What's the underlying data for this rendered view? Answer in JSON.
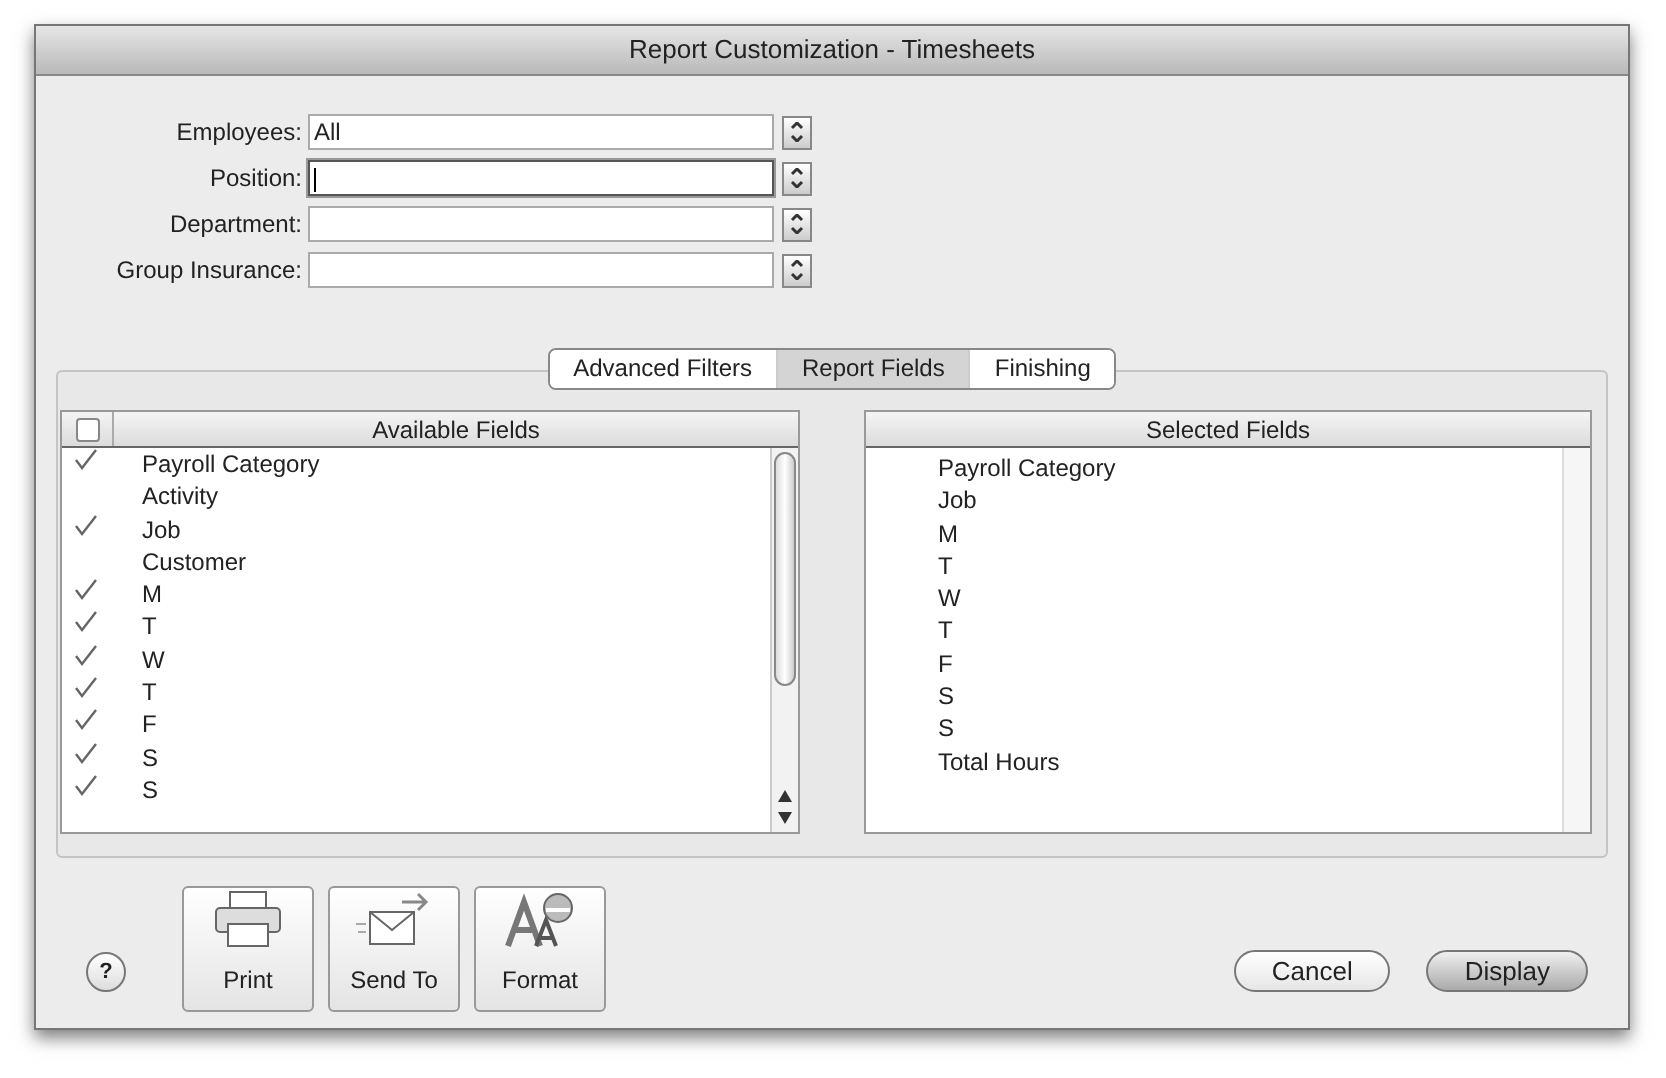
{
  "window": {
    "title": "Report Customization - Timesheets"
  },
  "filters": [
    {
      "label": "Employees:",
      "value": "All",
      "focused": false
    },
    {
      "label": "Position:",
      "focused": true
    },
    {
      "label": "Department:",
      "focused": false
    },
    {
      "label": "Group Insurance:",
      "focused": false
    }
  ],
  "tabs": [
    {
      "label": "Advanced Filters",
      "selected": false
    },
    {
      "label": "Report Fields",
      "selected": true
    },
    {
      "label": "Finishing",
      "selected": false
    }
  ],
  "available_fields": {
    "header": "Available Fields",
    "select_all_checked": false,
    "items": [
      {
        "label": "Payroll Category",
        "checked": true
      },
      {
        "label": "Activity",
        "checked": false
      },
      {
        "label": "Job",
        "checked": true
      },
      {
        "label": "Customer",
        "checked": false
      },
      {
        "label": "M",
        "checked": true
      },
      {
        "label": "T",
        "checked": true
      },
      {
        "label": "W",
        "checked": true
      },
      {
        "label": "T",
        "checked": true
      },
      {
        "label": "F",
        "checked": true
      },
      {
        "label": "S",
        "checked": true
      },
      {
        "label": "S",
        "checked": true
      }
    ]
  },
  "selected_fields": {
    "header": "Selected Fields",
    "items": [
      "Payroll Category",
      "Job",
      "M",
      "T",
      "W",
      "T",
      "F",
      "S",
      "S",
      "Total Hours"
    ]
  },
  "toolbar": [
    {
      "kind": "print",
      "label": "Print"
    },
    {
      "kind": "send",
      "label": "Send To"
    },
    {
      "kind": "format",
      "label": "Format"
    }
  ],
  "help": "?",
  "buttons": [
    {
      "label": "Cancel",
      "default": false
    },
    {
      "label": "Display",
      "default": true
    }
  ]
}
